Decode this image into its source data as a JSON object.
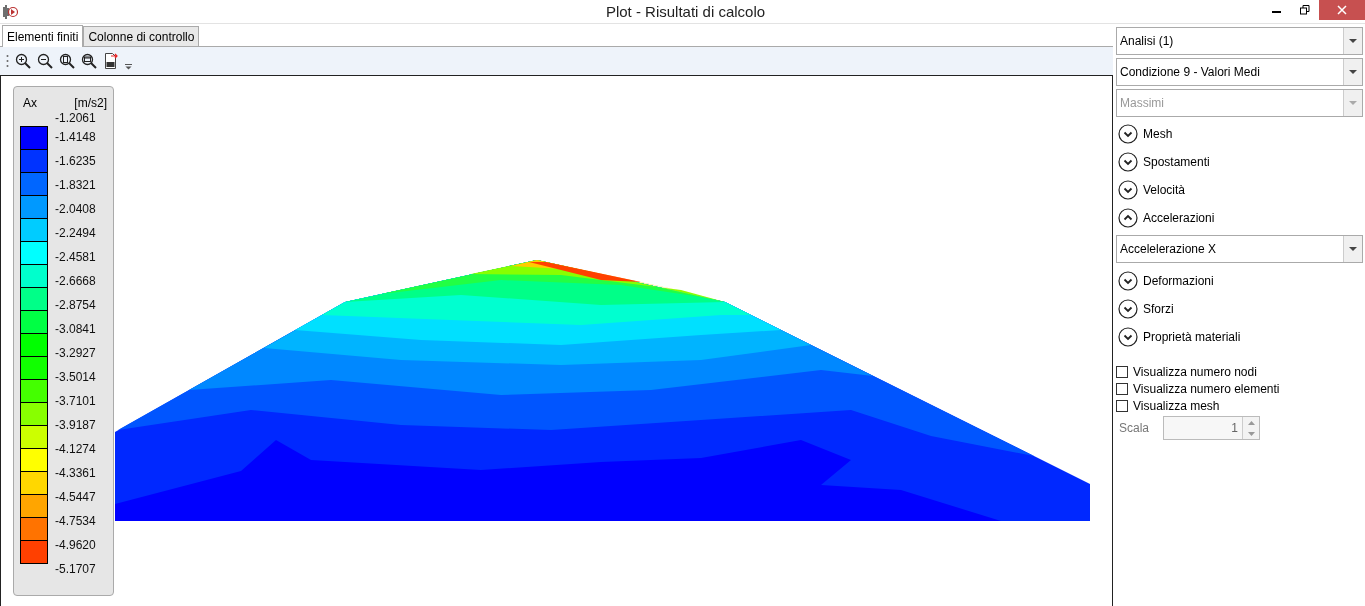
{
  "window": {
    "title": "Plot - Risultati di calcolo"
  },
  "tabs": [
    {
      "label": "Elementi finiti",
      "selected": true
    },
    {
      "label": "Colonne di controllo",
      "selected": false
    }
  ],
  "legend": {
    "quantity": "Ax",
    "unit": "[m/s2]",
    "labels": [
      "-1.2061",
      "-1.4148",
      "-1.6235",
      "-1.8321",
      "-2.0408",
      "-2.2494",
      "-2.4581",
      "-2.6668",
      "-2.8754",
      "-3.0841",
      "-3.2927",
      "-3.5014",
      "-3.7101",
      "-3.9187",
      "-4.1274",
      "-4.3361",
      "-4.5447",
      "-4.7534",
      "-4.9620",
      "-5.1707"
    ],
    "bands": [
      {
        "color": "#0000ff"
      },
      {
        "color": "#0033ff"
      },
      {
        "color": "#0066ff"
      },
      {
        "color": "#0099ff"
      },
      {
        "color": "#00ccff"
      },
      {
        "color": "#00ffff"
      },
      {
        "color": "#00ffcc"
      },
      {
        "color": "#00ff88"
      },
      {
        "color": "#00ff44"
      },
      {
        "color": "#00ff00"
      },
      {
        "color": "#11ff00"
      },
      {
        "color": "#44ff00"
      },
      {
        "color": "#88ff00"
      },
      {
        "color": "#ccff00"
      },
      {
        "color": "#ffff00"
      },
      {
        "color": "#ffd700"
      },
      {
        "color": "#ffa500"
      },
      {
        "color": "#ff7300"
      },
      {
        "color": "#ff4000"
      }
    ]
  },
  "panel": {
    "dropdowns": [
      {
        "value": "Analisi (1)",
        "disabled": false
      },
      {
        "value": "Condizione 9 - Valori Medi",
        "disabled": false
      },
      {
        "value": "Massimi",
        "disabled": true
      }
    ],
    "sections": [
      {
        "label": "Mesh",
        "expanded": false
      },
      {
        "label": "Spostamenti",
        "expanded": false
      },
      {
        "label": "Velocità",
        "expanded": false
      },
      {
        "label": "Accelerazioni",
        "expanded": true,
        "dropdown": {
          "value": "Accelelerazione X"
        }
      },
      {
        "label": "Deformazioni",
        "expanded": false
      },
      {
        "label": "Sforzi",
        "expanded": false
      },
      {
        "label": "Proprietà materiali",
        "expanded": false
      }
    ],
    "checkboxes": [
      {
        "label": "Visualizza numero nodi",
        "checked": false
      },
      {
        "label": "Visualizza numero elementi",
        "checked": false
      },
      {
        "label": "Visualizza mesh",
        "checked": false
      }
    ],
    "scale": {
      "label": "Scala",
      "value": "1",
      "disabled": true
    }
  }
}
